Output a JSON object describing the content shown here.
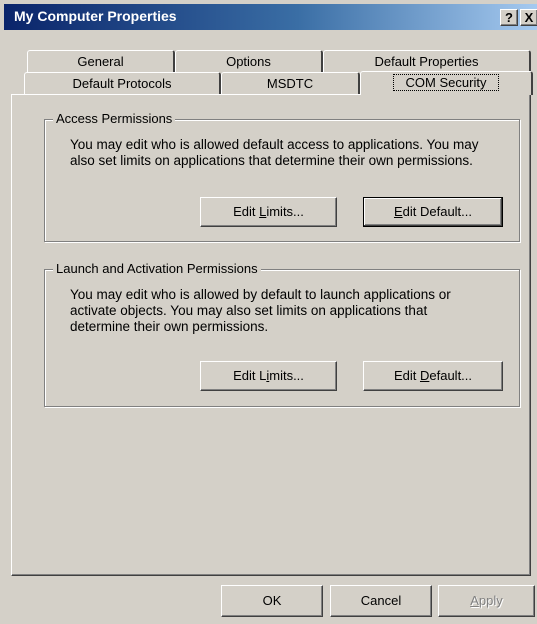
{
  "window": {
    "title": "My Computer Properties",
    "help_button": "?",
    "close_button": "X"
  },
  "tabs": {
    "row1": [
      "General",
      "Options",
      "Default Properties"
    ],
    "row2": [
      "Default Protocols",
      "MSDTC",
      "COM Security"
    ],
    "active": "COM Security"
  },
  "access": {
    "title": "Access Permissions",
    "desc_line1": "You may edit who is allowed default access to applications. You may",
    "desc_line2": "also set limits on applications that determine their own permissions.",
    "edit_limits": {
      "pre": "Edit ",
      "u": "L",
      "post": "imits..."
    },
    "edit_default": {
      "pre": "",
      "u": "E",
      "post": "dit Default..."
    }
  },
  "launch": {
    "title": "Launch and Activation Permissions",
    "desc_line1": "You may edit who is allowed by default to launch applications or",
    "desc_line2": "activate objects. You may also set limits on applications that",
    "desc_line3": "determine their own permissions.",
    "edit_limits": {
      "pre": "Edit L",
      "u": "i",
      "post": "mits..."
    },
    "edit_default": {
      "pre": "Edit ",
      "u": "D",
      "post": "efault..."
    }
  },
  "footer": {
    "ok": "OK",
    "cancel": "Cancel",
    "apply": {
      "pre": "",
      "u": "A",
      "post": "pply"
    }
  }
}
